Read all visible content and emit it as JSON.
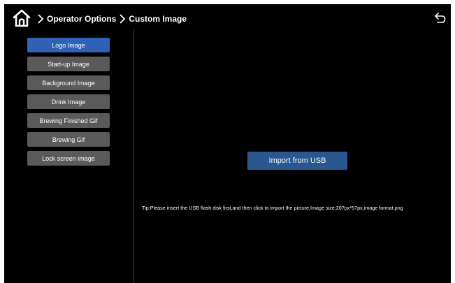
{
  "header": {
    "breadcrumb": [
      "Operator Options",
      "Custom Image"
    ],
    "home_icon": "home-icon",
    "back_icon": "back-arrow-icon"
  },
  "sidebar": {
    "items": [
      {
        "label": "Logo Image",
        "active": true
      },
      {
        "label": "Start-up Image",
        "active": false
      },
      {
        "label": "Background Image",
        "active": false
      },
      {
        "label": "Drink Image",
        "active": false
      },
      {
        "label": "Brewing Finished Gif",
        "active": false
      },
      {
        "label": "Brewing Gif",
        "active": false
      },
      {
        "label": "Lock screen image",
        "active": false
      }
    ]
  },
  "main": {
    "import_button": "Import from USB",
    "tip": "Tip:Please insert the USB flash disk first,and then click to import the picture.Image size:207px*57px,image format:png"
  },
  "colors": {
    "background": "#000000",
    "menu_active": "#2f62b7",
    "menu_inactive": "#5a5a5a",
    "import_button": "#2a578f",
    "text": "#ffffff"
  }
}
